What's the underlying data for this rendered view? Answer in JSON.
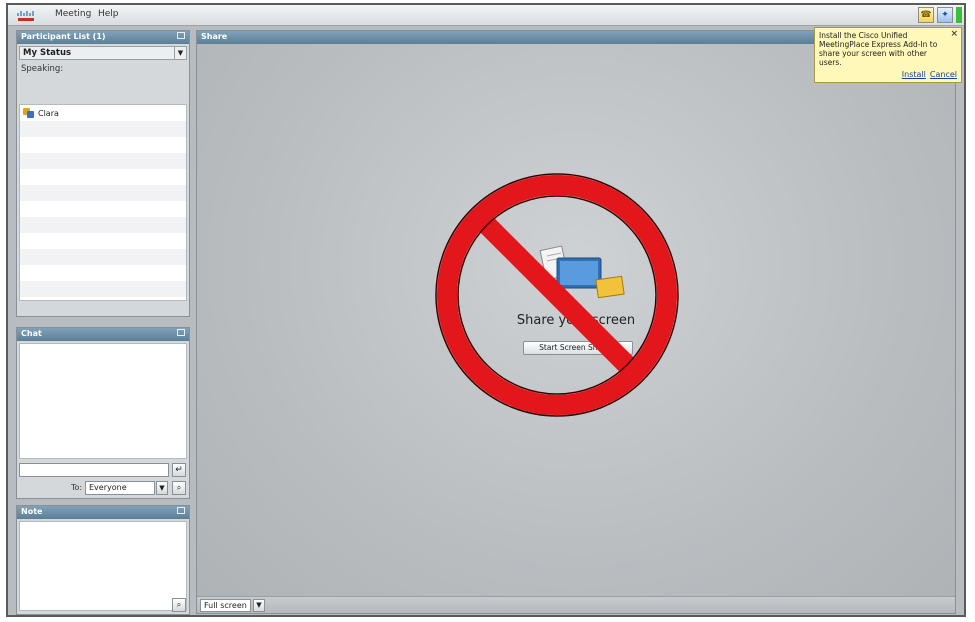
{
  "menubar": {
    "items": [
      "Meeting",
      "Help"
    ],
    "tray_icons": [
      "phone-icon",
      "info-icon",
      "status-indicator"
    ]
  },
  "participants_panel": {
    "title": "Participant List (1)",
    "status_label": "My Status",
    "speaking_label": "Speaking:",
    "participants": [
      "Clara"
    ]
  },
  "chat_panel": {
    "title": "Chat",
    "to_label": "To:",
    "to_value": "Everyone"
  },
  "note_panel": {
    "title": "Note"
  },
  "share_pod": {
    "title": "Share",
    "heading": "Share your screen",
    "button_label": "Start Screen Sharing",
    "footer_button": "Full screen"
  },
  "addin_tip": {
    "message": "Install the Cisco Unified MeetingPlace Express Add-In to share your screen with other users.",
    "install_label": "Install",
    "cancel_label": "Cancel"
  },
  "colors": {
    "panel_header": "#6b8ea6",
    "prohibition": "#e3161c",
    "tooltip": "#fff8b8"
  }
}
